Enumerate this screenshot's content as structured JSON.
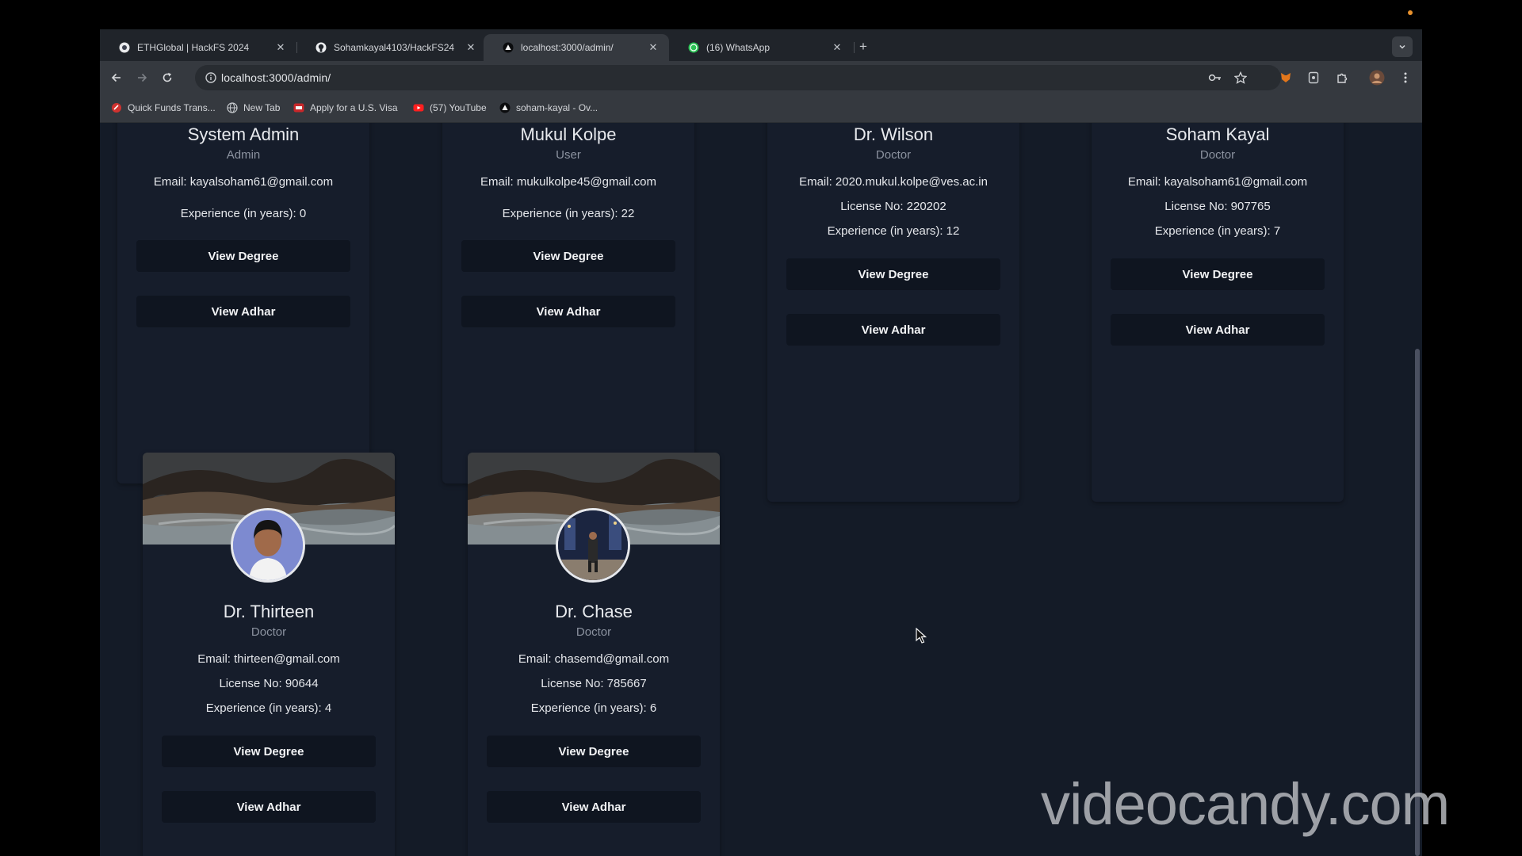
{
  "browser": {
    "tabs": [
      {
        "title": "ETHGlobal | HackFS 2024",
        "icon": "ethglobal-icon"
      },
      {
        "title": "Sohamkayal4103/HackFS24",
        "icon": "github-icon"
      },
      {
        "title": "localhost:3000/admin/",
        "icon": "vercel-triangle-icon"
      },
      {
        "title": "(16) WhatsApp",
        "icon": "whatsapp-icon"
      }
    ],
    "new_tab": "+",
    "url": "localhost:3000/admin/",
    "bookmarks": [
      {
        "label": "Quick Funds Trans...",
        "icon": "bookmark-app-icon"
      },
      {
        "label": "New Tab",
        "icon": "globe-icon"
      },
      {
        "label": "Apply for a U.S. Visa",
        "icon": "visa-site-icon"
      },
      {
        "label": "(57) YouTube",
        "icon": "youtube-icon"
      },
      {
        "label": "soham-kayal - Ov...",
        "icon": "vercel-triangle-icon"
      }
    ],
    "colors": {
      "accent_orange": "#e8912d",
      "page_bg": "#141b27",
      "card_bg": "#161d2b"
    }
  },
  "users_top": [
    {
      "name": "System Admin",
      "role": "Admin",
      "email": "Email: kayalsoham61@gmail.com",
      "experience": "Experience (in years): 0",
      "view_degree": "View Degree",
      "view_adhar": "View Adhar"
    },
    {
      "name": "Mukul Kolpe",
      "role": "User",
      "email": "Email: mukulkolpe45@gmail.com",
      "experience": "Experience (in years): 22",
      "view_degree": "View Degree",
      "view_adhar": "View Adhar"
    },
    {
      "name": "Dr. Wilson",
      "role": "Doctor",
      "email": "Email: 2020.mukul.kolpe@ves.ac.in",
      "license": "License No: 220202",
      "experience": "Experience (in years): 12",
      "view_degree": "View Degree",
      "view_adhar": "View Adhar"
    },
    {
      "name": "Soham Kayal",
      "role": "Doctor",
      "email": "Email: kayalsoham61@gmail.com",
      "license": "License No: 907765",
      "experience": "Experience (in years): 7",
      "view_degree": "View Degree",
      "view_adhar": "View Adhar"
    }
  ],
  "users_bottom": [
    {
      "name": "Dr. Thirteen",
      "role": "Doctor",
      "email": "Email: thirteen@gmail.com",
      "license": "License No: 90644",
      "experience": "Experience (in years): 4",
      "view_degree": "View Degree",
      "view_adhar": "View Adhar"
    },
    {
      "name": "Dr. Chase",
      "role": "Doctor",
      "email": "Email: chasemd@gmail.com",
      "license": "License No: 785667",
      "experience": "Experience (in years): 6",
      "view_degree": "View Degree",
      "view_adhar": "View Adhar"
    }
  ],
  "watermark": "videocandy.com"
}
